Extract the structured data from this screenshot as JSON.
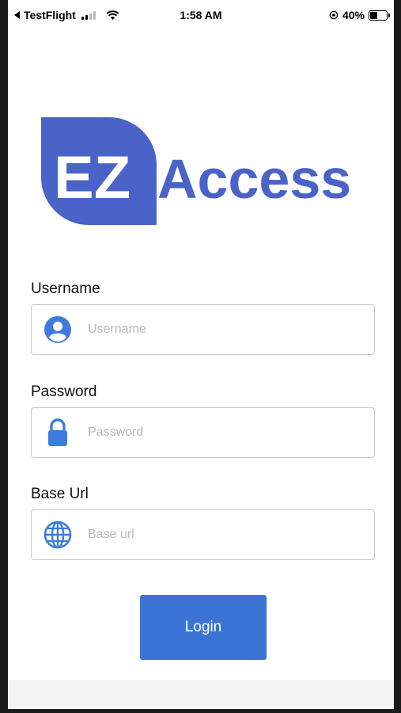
{
  "status_bar": {
    "back_app": "TestFlight",
    "time": "1:58 AM",
    "battery": "40%"
  },
  "logo": {
    "left_text": "EZ",
    "right_text": "Access",
    "brand_color": "#4a63c9"
  },
  "form": {
    "username": {
      "label": "Username",
      "placeholder": "Username",
      "value": "",
      "icon": "user-circle-icon"
    },
    "password": {
      "label": "Password",
      "placeholder": "Password",
      "value": "",
      "icon": "lock-icon"
    },
    "base_url": {
      "label": "Base Url",
      "placeholder": "Base url",
      "value": "",
      "icon": "globe-icon"
    }
  },
  "login_button": {
    "label": "Login",
    "color": "#3a75d6"
  },
  "colors": {
    "icon_blue": "#3d7be0",
    "field_border": "#c9c9c9"
  }
}
